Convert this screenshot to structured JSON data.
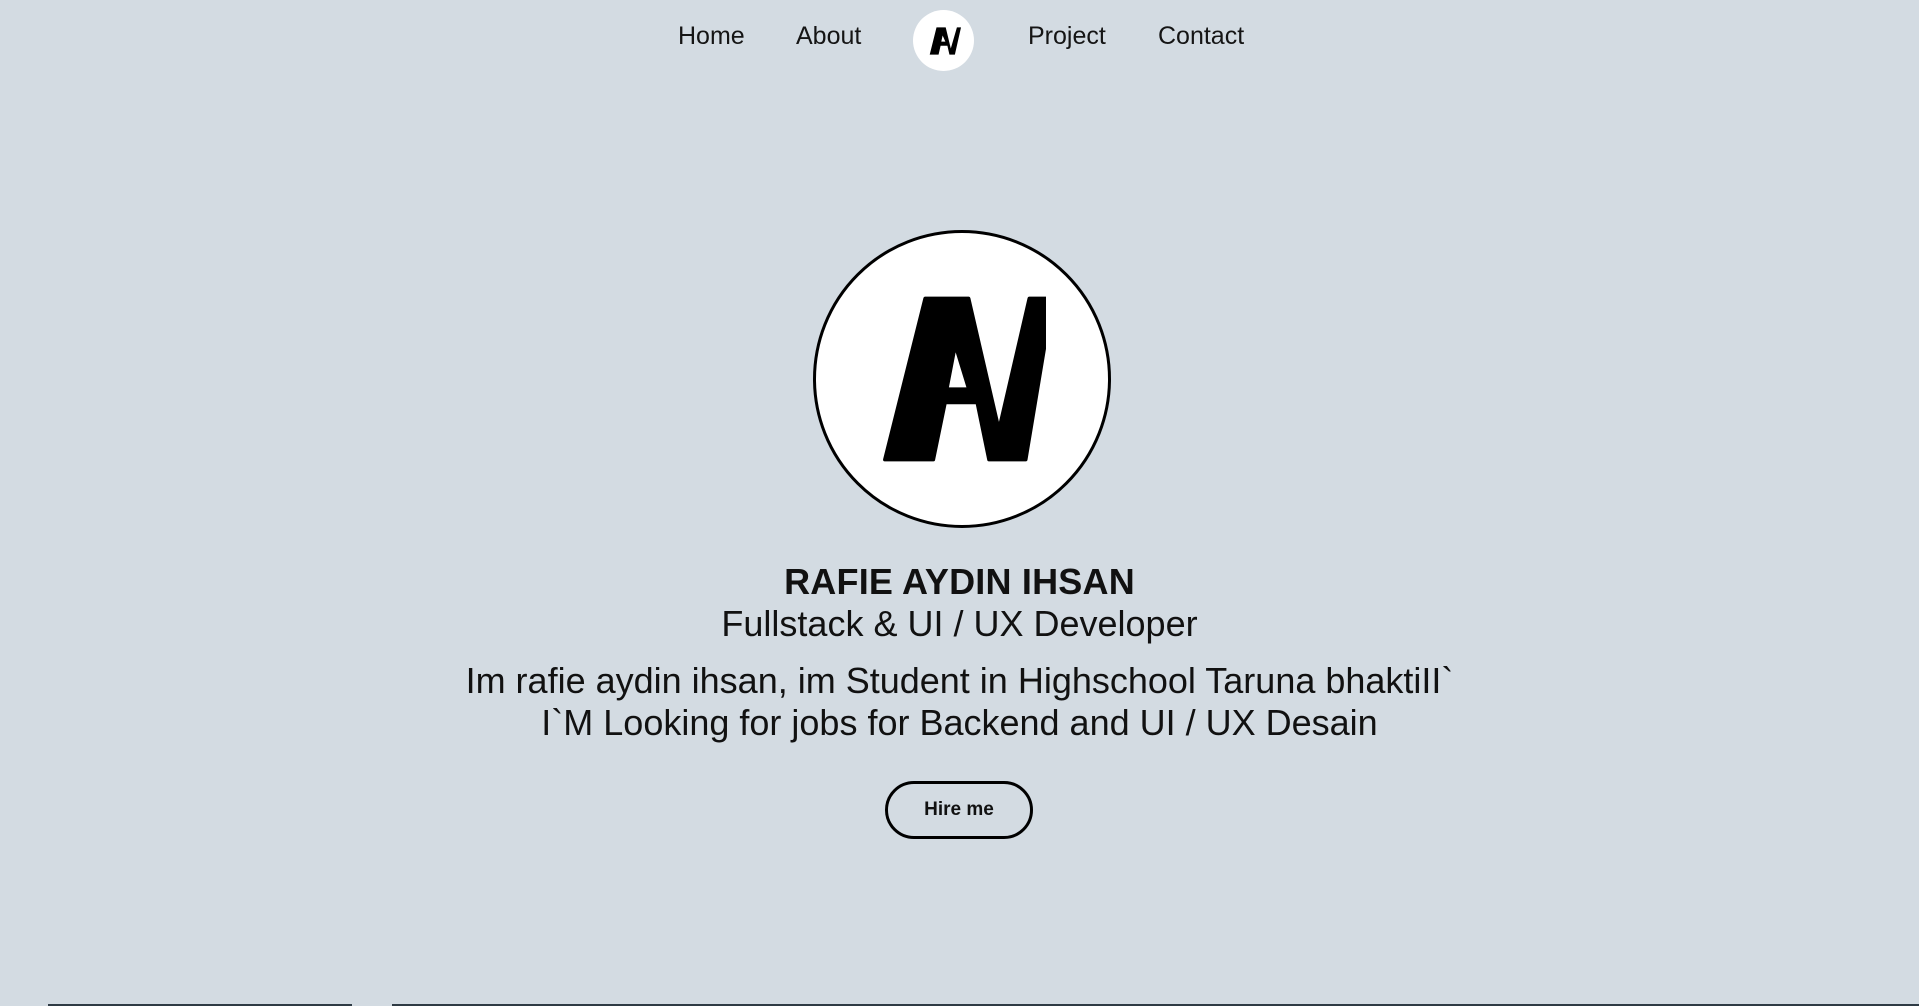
{
  "nav": {
    "items": [
      {
        "label": "Home"
      },
      {
        "label": "About"
      },
      {
        "label": "Project"
      },
      {
        "label": "Contact"
      }
    ],
    "logo_icon": "ai-logo-icon"
  },
  "hero": {
    "avatar_icon": "ai-logo-icon",
    "name": "RAFIE AYDIN IHSAN",
    "role": "Fullstack & UI / UX Developer",
    "bio_line_1": "Im rafie aydin ihsan, im Student in Highschool Taruna bhaktiII`",
    "bio_line_2": "I`M Looking for jobs for Backend and UI / UX Desain",
    "cta_label": "Hire me"
  },
  "colors": {
    "background": "#d3dbe2",
    "text": "#111111",
    "logo_fill": "#000000",
    "logo_bg": "#ffffff"
  }
}
